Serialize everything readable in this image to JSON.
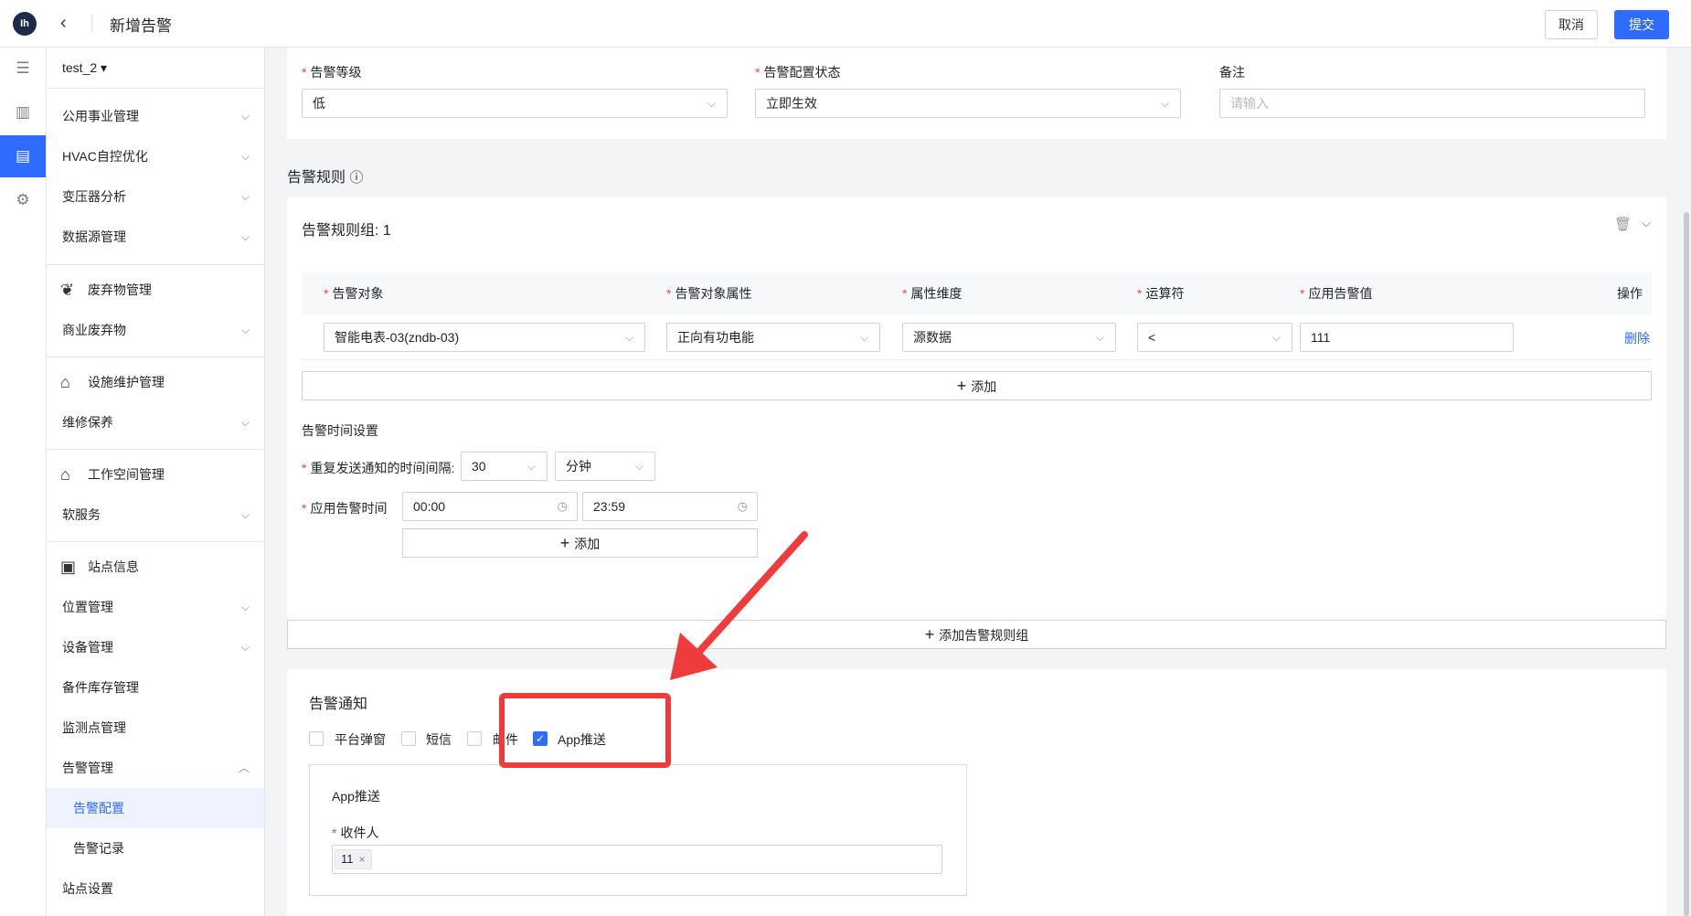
{
  "header": {
    "logo_text": "Ih",
    "back_icon": "chevron-left-icon",
    "title": "新增告警",
    "cancel": "取消",
    "submit": "提交",
    "accent": "#2f6bff"
  },
  "iconbar": {
    "items": [
      "menu-icon",
      "building-icon",
      "document-icon",
      "gear-icon"
    ],
    "active_index": 2
  },
  "sidebar": {
    "project": "test_2 ▾",
    "items": [
      {
        "label": "公用事业管理",
        "chevron": "⌵"
      },
      {
        "label": "HVAC自控优化",
        "chevron": "⌵"
      },
      {
        "label": "变压器分析",
        "chevron": "⌵"
      },
      {
        "label": "数据源管理",
        "chevron": "⌵"
      },
      {
        "label": "废弃物管理",
        "icon": "❦"
      },
      {
        "label": "商业废弃物",
        "chevron": "⌵"
      },
      {
        "label": "设施维护管理",
        "icon": "⌂"
      },
      {
        "label": "维修保养",
        "chevron": "⌵"
      },
      {
        "label": "工作空间管理",
        "icon": "⌂"
      },
      {
        "label": "软服务",
        "chevron": "⌵"
      },
      {
        "label": "站点信息",
        "icon": "▣"
      },
      {
        "label": "位置管理",
        "chevron": "⌵"
      },
      {
        "label": "设备管理",
        "chevron": "⌵"
      },
      {
        "label": "备件库存管理"
      },
      {
        "label": "监测点管理"
      },
      {
        "label": "告警管理",
        "chevron": "︿"
      },
      {
        "label": "告警配置"
      },
      {
        "label": "告警记录"
      },
      {
        "label": "站点设置"
      }
    ]
  },
  "basic": {
    "level_label": "告警等级",
    "level_value": "低",
    "status_label": "告警配置状态",
    "status_value": "立即生效",
    "note_label": "备注",
    "note_placeholder": "请输入"
  },
  "rules": {
    "title": "告警规则",
    "info_icon": "ⓘ",
    "group_title": "告警规则组: 1",
    "trash_icon": "🗑",
    "collapse_icon": "⌵",
    "headers": [
      "告警对象",
      "告警对象属性",
      "属性维度",
      "运算符",
      "应用告警值",
      "操作"
    ],
    "row": {
      "object": "智能电表-03(zndb-03)",
      "attribute": "正向有功电能",
      "dimension": "源数据",
      "operator": "<",
      "value": "111",
      "action": "删除"
    },
    "add": "添加",
    "time_settings": "告警时间设置",
    "interval_label": "重复发送通知的时间间隔:",
    "interval_value": "30",
    "interval_unit": "分钟",
    "apply_time_label": "应用告警时间",
    "start_time": "00:00",
    "end_time": "23:59",
    "add_time": "添加",
    "add_group": "添加告警规则组"
  },
  "notify": {
    "title": "告警通知",
    "options": [
      {
        "label": "平台弹窗",
        "checked": false
      },
      {
        "label": "短信",
        "checked": false
      },
      {
        "label": "邮件",
        "checked": false
      },
      {
        "label": "App推送",
        "checked": true
      }
    ],
    "app_title": "App推送",
    "recipient_label": "收件人",
    "recipient_tag": "11",
    "tag_close": "×"
  },
  "annotation": {
    "color": "#ef3b3b"
  }
}
